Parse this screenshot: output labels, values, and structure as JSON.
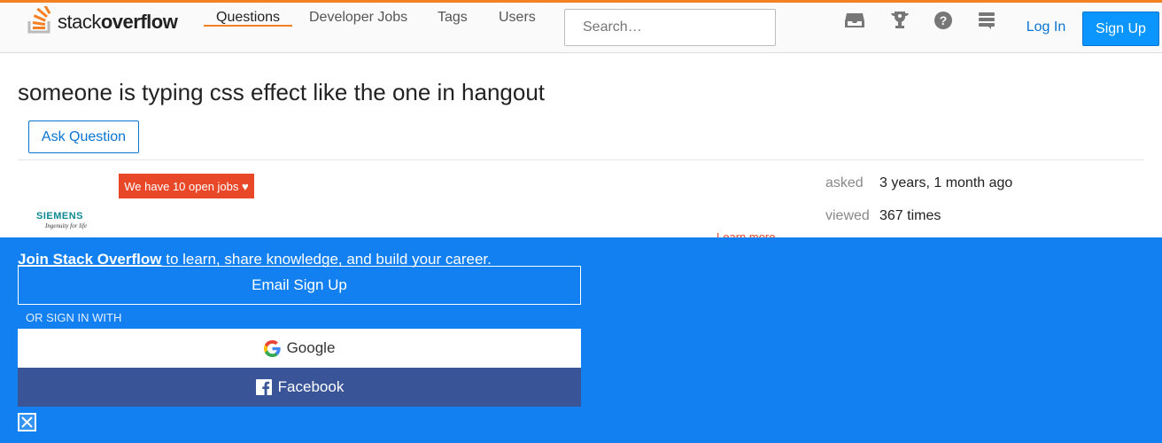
{
  "header": {
    "logo_light": "stack",
    "logo_bold": "overflow",
    "nav": [
      {
        "label": "Questions",
        "active": true
      },
      {
        "label": "Developer Jobs",
        "active": false
      },
      {
        "label": "Tags",
        "active": false
      },
      {
        "label": "Users",
        "active": false
      }
    ],
    "search_placeholder": "Search…",
    "icons": [
      "inbox-icon",
      "achievements-icon",
      "help-icon",
      "site-switcher-icon"
    ],
    "login_label": "Log In",
    "signup_label": "Sign Up",
    "accent_color": "#f48024"
  },
  "question": {
    "title": "someone is typing css effect like the one in hangout",
    "ask_label": "Ask Question"
  },
  "ad": {
    "jobs_badge": "We have 10 open jobs ♥",
    "company": "SIEMENS",
    "tagline": "Ingenuity for life",
    "learn_more": "Learn more"
  },
  "meta": {
    "asked_label": "asked",
    "asked_value": "3 years, 1 month ago",
    "viewed_label": "viewed",
    "viewed_value": "367 times"
  },
  "signup_banner": {
    "join_bold": "Join Stack Overflow",
    "join_rest": " to learn, share knowledge, and build your career.",
    "email_label": "Email Sign Up",
    "or_label": "OR SIGN IN WITH",
    "google_label": "Google",
    "facebook_label": "Facebook",
    "background_color": "#1280f0"
  }
}
